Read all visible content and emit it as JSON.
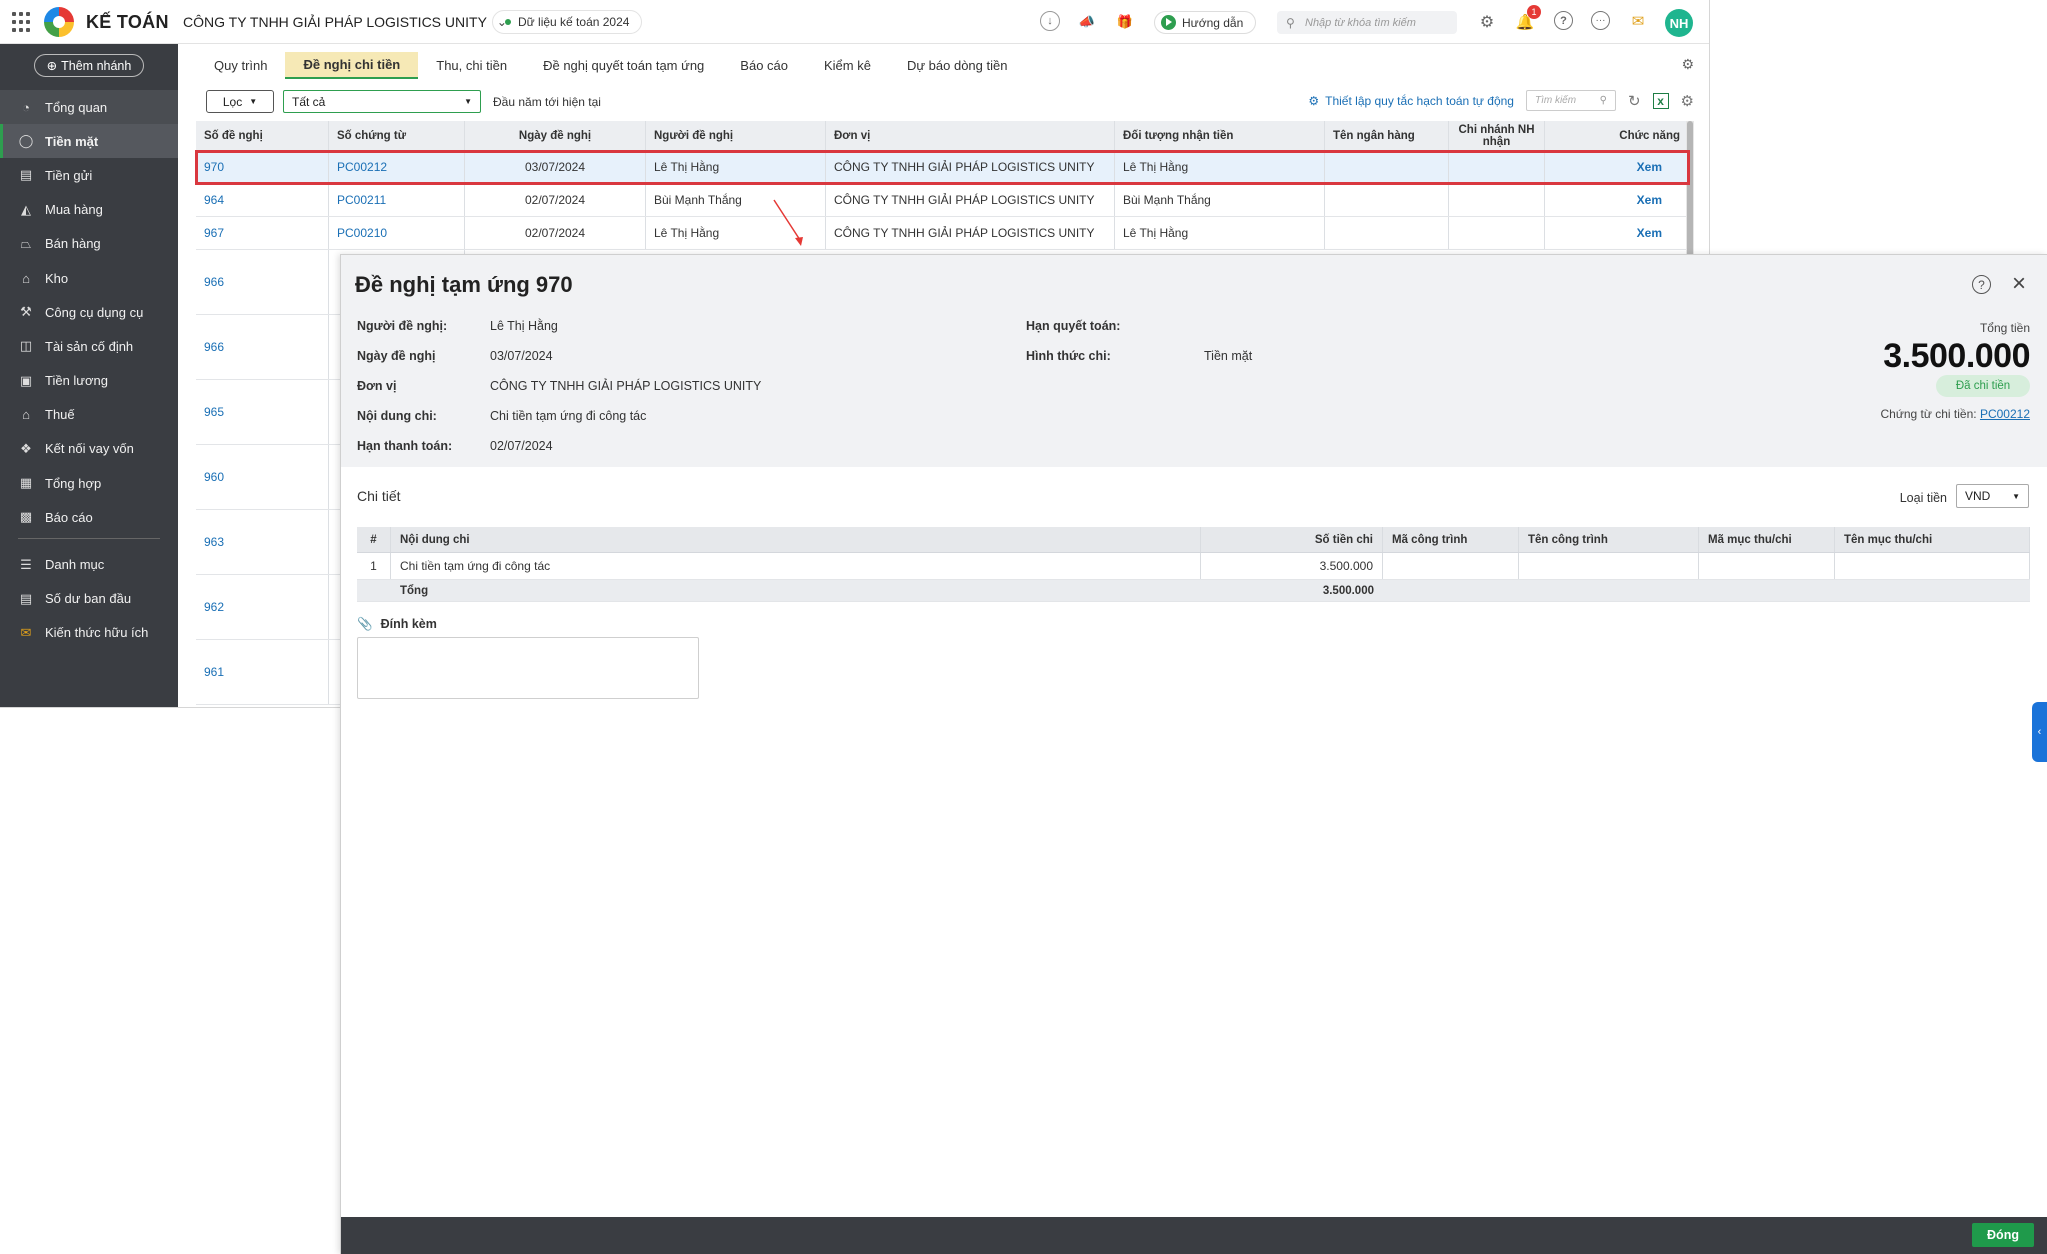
{
  "topbar": {
    "brand": "KẾ TOÁN",
    "company": "CÔNG TY TNHH GIẢI PHÁP LOGISTICS UNITY",
    "data_year": "Dữ liệu kế toán 2024",
    "guide_label": "Hướng dẫn",
    "search_placeholder": "Nhập từ khóa tìm kiếm",
    "notification_count": "1",
    "avatar_initials": "NH"
  },
  "sidebar": {
    "add_branch": "Thêm nhánh",
    "items": [
      {
        "label": "Tổng quan",
        "icon": "speedometer-icon"
      },
      {
        "label": "Tiền mặt",
        "icon": "cash-bag-icon"
      },
      {
        "label": "Tiền gửi",
        "icon": "bank-icon"
      },
      {
        "label": "Mua hàng",
        "icon": "shopping-bag-icon"
      },
      {
        "label": "Bán hàng",
        "icon": "cart-icon"
      },
      {
        "label": "Kho",
        "icon": "warehouse-icon"
      },
      {
        "label": "Công cụ dụng cụ",
        "icon": "tools-icon"
      },
      {
        "label": "Tài sản cố định",
        "icon": "asset-icon"
      },
      {
        "label": "Tiền lương",
        "icon": "payroll-icon"
      },
      {
        "label": "Thuế",
        "icon": "tax-building-icon"
      },
      {
        "label": "Kết nối vay vốn",
        "icon": "loan-icon"
      },
      {
        "label": "Tổng hợp",
        "icon": "ledger-icon"
      },
      {
        "label": "Báo cáo",
        "icon": "bar-chart-icon"
      },
      {
        "label": "Danh mục",
        "icon": "list-icon"
      },
      {
        "label": "Số dư ban đầu",
        "icon": "opening-balance-icon"
      },
      {
        "label": "Kiến thức hữu ích",
        "icon": "knowledge-icon"
      }
    ]
  },
  "tabs": [
    "Quy trình",
    "Đề nghị chi tiền",
    "Thu, chi tiền",
    "Đề nghị quyết toán tạm ứng",
    "Báo cáo",
    "Kiểm kê",
    "Dự báo dòng tiền"
  ],
  "filters": {
    "filter_label": "Lọc",
    "status_value": "Tất cả",
    "period": "Đầu năm tới hiện tại",
    "auto_rule": "Thiết lập quy tắc hạch toán tự động",
    "search_placeholder": "Tìm kiếm"
  },
  "grid": {
    "columns": [
      "Số đề nghị",
      "Số chứng từ",
      "Ngày đề nghị",
      "Người đề nghị",
      "Đơn vị",
      "Đối tượng nhận tiền",
      "Tên ngân hàng",
      "Chi nhánh NH nhận",
      "Chức năng"
    ],
    "rows": [
      {
        "so_de_nghi": "970",
        "so_chung_tu": "PC00212",
        "ngay": "03/07/2024",
        "nguoi": "Lê Thị Hằng",
        "don_vi": "CÔNG TY TNHH GIẢI PHÁP LOGISTICS UNITY",
        "doi_tuong": "Lê Thị Hằng",
        "chuc_nang": "Xem"
      },
      {
        "so_de_nghi": "964",
        "so_chung_tu": "PC00211",
        "ngay": "02/07/2024",
        "nguoi": "Bùi Mạnh Thắng",
        "don_vi": "CÔNG TY TNHH GIẢI PHÁP LOGISTICS UNITY",
        "doi_tuong": "Bùi Mạnh Thắng",
        "chuc_nang": "Xem"
      },
      {
        "so_de_nghi": "967",
        "so_chung_tu": "PC00210",
        "ngay": "02/07/2024",
        "nguoi": "Lê Thị Hằng",
        "don_vi": "CÔNG TY TNHH GIẢI PHÁP LOGISTICS UNITY",
        "doi_tuong": "Lê Thị Hằng",
        "chuc_nang": "Xem"
      }
    ],
    "hidden_rows": [
      "966",
      "966",
      "965",
      "960",
      "963",
      "962",
      "961"
    ]
  },
  "panel": {
    "title": "Đề nghị tạm ứng 970",
    "fields": {
      "nguoi_de_nghi_label": "Người đề nghị:",
      "nguoi_de_nghi": "Lê Thị Hằng",
      "ngay_de_nghi_label": "Ngày đề nghị",
      "ngay_de_nghi": "03/07/2024",
      "don_vi_label": "Đơn vị",
      "don_vi": "CÔNG TY TNHH GIẢI PHÁP LOGISTICS UNITY",
      "noi_dung_label": "Nội dung chi:",
      "noi_dung": "Chi tiền tạm ứng đi công tác",
      "han_tt_label": "Hạn thanh toán:",
      "han_tt": "02/07/2024",
      "han_qt_label": "Hạn quyết toán:",
      "han_qt": "",
      "hinh_thuc_label": "Hình thức chi:",
      "hinh_thuc": "Tiền mặt"
    },
    "total_label": "Tổng tiền",
    "total_value": "3.500.000",
    "status": "Đã chi tiền",
    "voucher_label": "Chứng từ chi tiền:",
    "voucher_no": "PC00212",
    "detail_title": "Chi tiết",
    "currency_label": "Loại tiền",
    "currency": "VND",
    "detail_columns": [
      "#",
      "Nội dung chi",
      "Số tiền chi",
      "Mã công trình",
      "Tên công trình",
      "Mã mục thu/chi",
      "Tên mục thu/chi"
    ],
    "detail_rows": [
      {
        "no": "1",
        "content": "Chi tiền tạm ứng đi công tác",
        "amount": "3.500.000"
      }
    ],
    "detail_total_label": "Tổng",
    "detail_total": "3.500.000",
    "attach_label": "Đính kèm",
    "close_label": "Đóng"
  }
}
